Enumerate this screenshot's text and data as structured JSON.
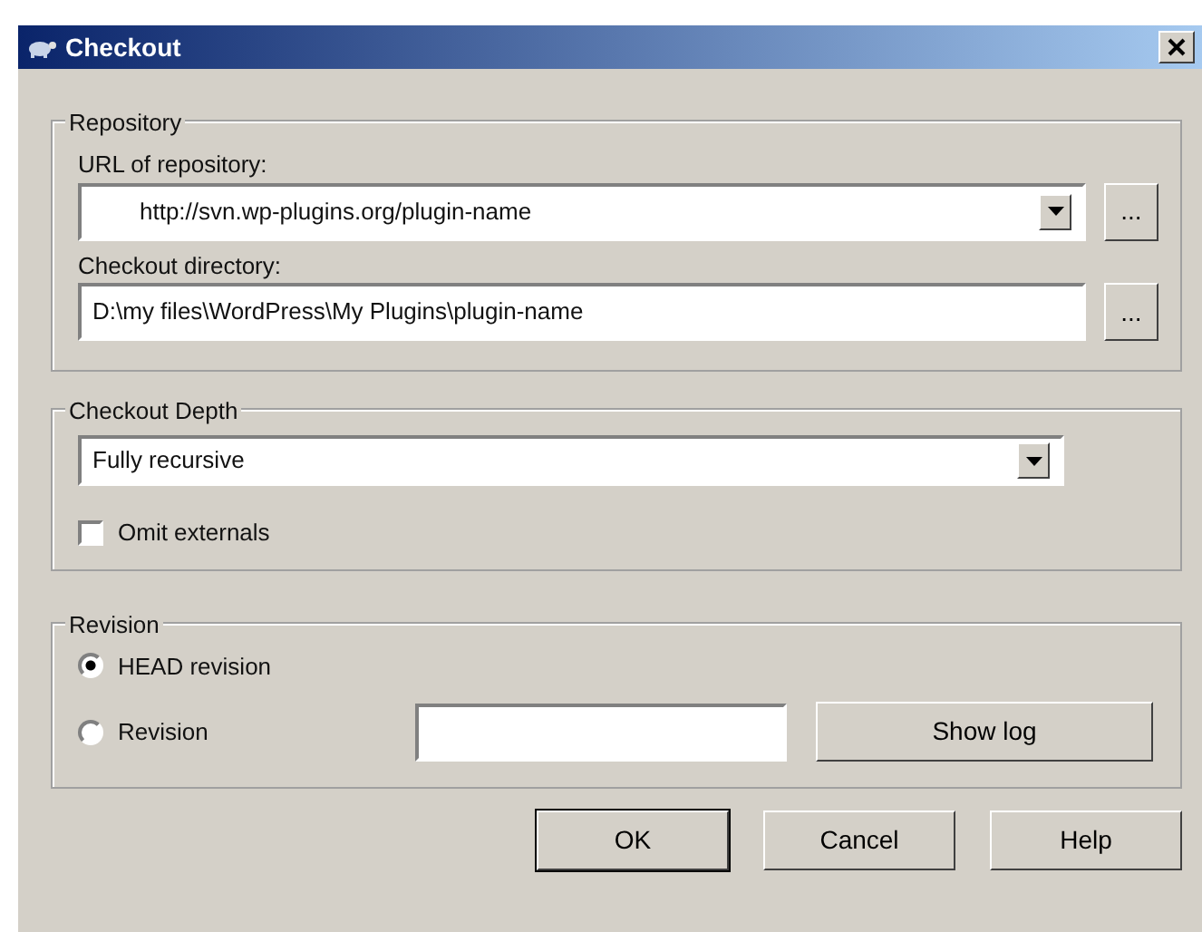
{
  "window": {
    "title": "Checkout"
  },
  "repository": {
    "label": "Repository",
    "url_label": "URL of repository:",
    "url_value": "http://svn.wp-plugins.org/plugin-name",
    "url_browse": "...",
    "dir_label": "Checkout directory:",
    "dir_value": "D:\\my files\\WordPress\\My Plugins\\plugin-name",
    "dir_browse": "..."
  },
  "depth": {
    "label": "Checkout Depth",
    "value": "Fully recursive",
    "omit_externals": {
      "label": "Omit externals",
      "checked": false
    }
  },
  "revision": {
    "label": "Revision",
    "options": [
      {
        "label": "HEAD revision",
        "selected": true
      },
      {
        "label": "Revision",
        "selected": false
      }
    ],
    "show_log": "Show log"
  },
  "buttons": [
    {
      "label": "OK",
      "default": true
    },
    {
      "label": "Cancel",
      "default": false
    },
    {
      "label": "Help",
      "default": false
    }
  ]
}
